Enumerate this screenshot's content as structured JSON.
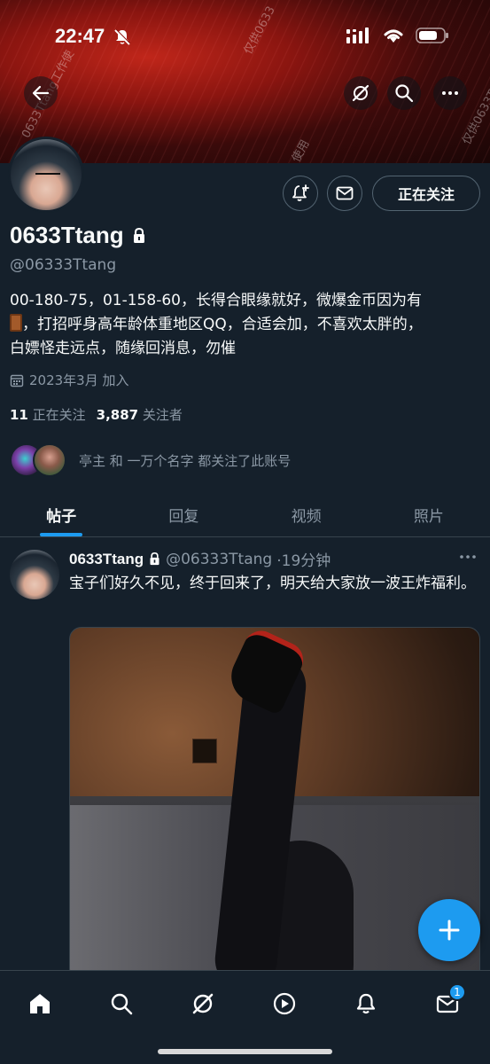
{
  "status_bar": {
    "time": "22:47"
  },
  "banner": {
    "watermarks": [
      "仅供0633",
      "0633Ttang工作使",
      "使用",
      "仅供0633Tt"
    ]
  },
  "profile": {
    "display_name": "0633Ttang",
    "handle": "@06333Ttang",
    "bio_line1": "00-180-75，01-158-60，长得合眼缘就好，微爆金币因为有",
    "bio_line2": "，打招呼身高年龄体重地区QQ，合适会加，不喜欢太胖的，",
    "bio_line3": "白嫖怪走远点，随缘回消息，勿催",
    "joined": "2023年3月 加入",
    "following_count": "11",
    "following_label": "正在关注",
    "followers_count": "3,887",
    "followers_label": "关注者",
    "mutual_text": "亭主 和 一万个名字 都关注了此账号",
    "follow_button": "正在关注"
  },
  "tabs": [
    "帖子",
    "回复",
    "视频",
    "照片"
  ],
  "active_tab": 0,
  "post": {
    "author": "0633Ttang",
    "handle": "@06333Ttang",
    "time": "·19分钟",
    "text": "宝子们好久不见，终于回来了，明天给大家放一波王炸福利。"
  },
  "nav": {
    "messages_badge": "1"
  },
  "colors": {
    "background": "#15202b",
    "accent": "#1d9bf0",
    "muted": "#8b98a5"
  }
}
